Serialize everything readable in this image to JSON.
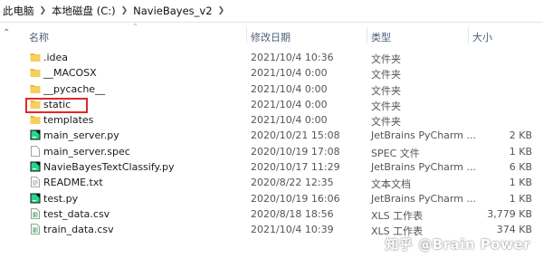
{
  "breadcrumb": [
    "此电脑",
    "本地磁盘 (C:)",
    "NavieBayes_v2"
  ],
  "columns": {
    "name": "名称",
    "date": "修改日期",
    "type": "类型",
    "size": "大小"
  },
  "files": [
    {
      "name": ".idea",
      "date": "2021/10/4 10:36",
      "type": "文件夹",
      "size": "",
      "icon": "folder-icon"
    },
    {
      "name": "__MACOSX",
      "date": "2021/10/4 0:00",
      "type": "文件夹",
      "size": "",
      "icon": "folder-icon"
    },
    {
      "name": "__pycache__",
      "date": "2021/10/4 0:00",
      "type": "文件夹",
      "size": "",
      "icon": "folder-icon"
    },
    {
      "name": "static",
      "date": "2021/10/4 0:00",
      "type": "文件夹",
      "size": "",
      "icon": "folder-icon"
    },
    {
      "name": "templates",
      "date": "2021/10/4 0:00",
      "type": "文件夹",
      "size": "",
      "icon": "folder-icon"
    },
    {
      "name": "main_server.py",
      "date": "2020/10/21 15:08",
      "type": "JetBrains PyCharm ...",
      "size": "2 KB",
      "icon": "pycharm-file-icon"
    },
    {
      "name": "main_server.spec",
      "date": "2020/10/19 17:08",
      "type": "SPEC 文件",
      "size": "1 KB",
      "icon": "generic-file-icon"
    },
    {
      "name": "NavieBayesTextClassify.py",
      "date": "2020/10/17 11:29",
      "type": "JetBrains PyCharm ...",
      "size": "6 KB",
      "icon": "pycharm-file-icon"
    },
    {
      "name": "README.txt",
      "date": "2020/8/22 12:35",
      "type": "文本文档",
      "size": "1 KB",
      "icon": "text-file-icon"
    },
    {
      "name": "test.py",
      "date": "2020/10/19 16:06",
      "type": "JetBrains PyCharm ...",
      "size": "1 KB",
      "icon": "pycharm-file-icon"
    },
    {
      "name": "test_data.csv",
      "date": "2020/8/18 18:56",
      "type": "XLS 工作表",
      "size": "3,779 KB",
      "icon": "csv-file-icon"
    },
    {
      "name": "train_data.csv",
      "date": "2021/10/4 10:39",
      "type": "XLS 工作表",
      "size": "374 KB",
      "icon": "csv-file-icon"
    }
  ],
  "watermark": "知乎 @Brain Power"
}
